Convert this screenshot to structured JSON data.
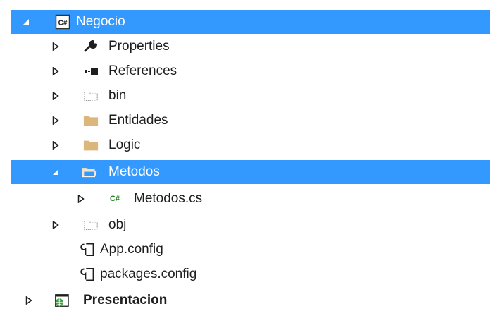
{
  "tree": {
    "project": {
      "label": "Negocio",
      "icon": "csharp-project-icon"
    },
    "items": [
      {
        "label": "Properties",
        "icon": "wrench-icon"
      },
      {
        "label": "References",
        "icon": "references-icon"
      },
      {
        "label": "bin",
        "icon": "hidden-folder-icon"
      },
      {
        "label": "Entidades",
        "icon": "folder-icon"
      },
      {
        "label": "Logic",
        "icon": "folder-icon"
      },
      {
        "label": "Metodos",
        "icon": "open-folder-icon"
      },
      {
        "label": "Metodos.cs",
        "icon": "csharp-file-icon"
      },
      {
        "label": "obj",
        "icon": "hidden-folder-icon"
      },
      {
        "label": "App.config",
        "icon": "config-file-icon"
      },
      {
        "label": "packages.config",
        "icon": "config-file-icon"
      }
    ],
    "solution_project": {
      "label": "Presentacion",
      "icon": "web-project-icon"
    },
    "cs_badge": "C#"
  },
  "colors": {
    "selection": "#3399ff",
    "folder": "#dcb67a",
    "csharp_green": "#1a7f1a"
  }
}
